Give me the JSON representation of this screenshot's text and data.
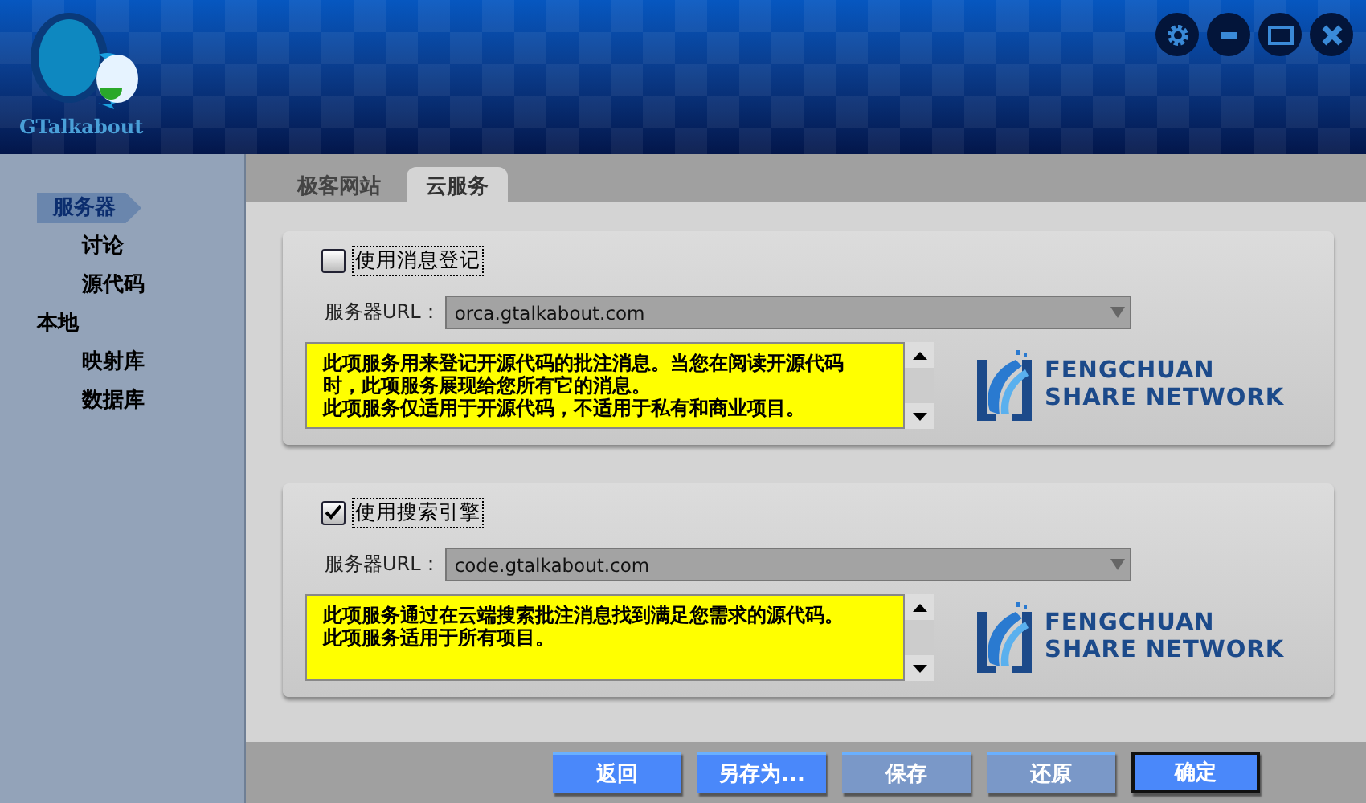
{
  "app": {
    "name": "GTalkabout"
  },
  "window_buttons": [
    {
      "kind": "settings"
    },
    {
      "kind": "minimize"
    },
    {
      "kind": "maximize"
    },
    {
      "kind": "close"
    }
  ],
  "sidebar": {
    "items": [
      {
        "label": "服务器",
        "selected": true,
        "children": [
          {
            "label": "讨论",
            "selected": false
          },
          {
            "label": "源代码",
            "selected": false
          }
        ]
      },
      {
        "label": "本地",
        "selected": false,
        "children": [
          {
            "label": "映射库",
            "selected": false
          },
          {
            "label": "数据库",
            "selected": false
          }
        ]
      }
    ]
  },
  "tabs": [
    {
      "label": "极客网站",
      "selected": false
    },
    {
      "label": "云服务",
      "selected": true
    }
  ],
  "services": [
    {
      "label": "使用消息登记",
      "checked": false,
      "url_label": "服务器URL：",
      "url": "orca.gtalkabout.com",
      "description": [
        "此项服务用来登记开源代码的批注消息。当您在阅读开源代码时，此项服务展现给您所有它的消息。",
        "此项服务仅适用于开源代码，不适用于私有和商业项目。"
      ],
      "logo": [
        "FENGCHUAN",
        "SHARE NETWORK"
      ]
    },
    {
      "label": "使用搜索引擎",
      "checked": true,
      "url_label": "服务器URL：",
      "url": "code.gtalkabout.com",
      "description": [
        "此项服务通过在云端搜索批注消息找到满足您需求的源代码。",
        "此项服务适用于所有项目。"
      ],
      "logo": [
        "FENGCHUAN",
        "SHARE NETWORK"
      ]
    }
  ],
  "buttons": [
    {
      "label": "返回",
      "disabled": false,
      "default": false
    },
    {
      "label": "另存为...",
      "disabled": false,
      "default": false
    },
    {
      "label": "保存",
      "disabled": true,
      "default": false
    },
    {
      "label": "还原",
      "disabled": true,
      "default": false
    },
    {
      "label": "确定",
      "disabled": false,
      "default": true
    }
  ]
}
